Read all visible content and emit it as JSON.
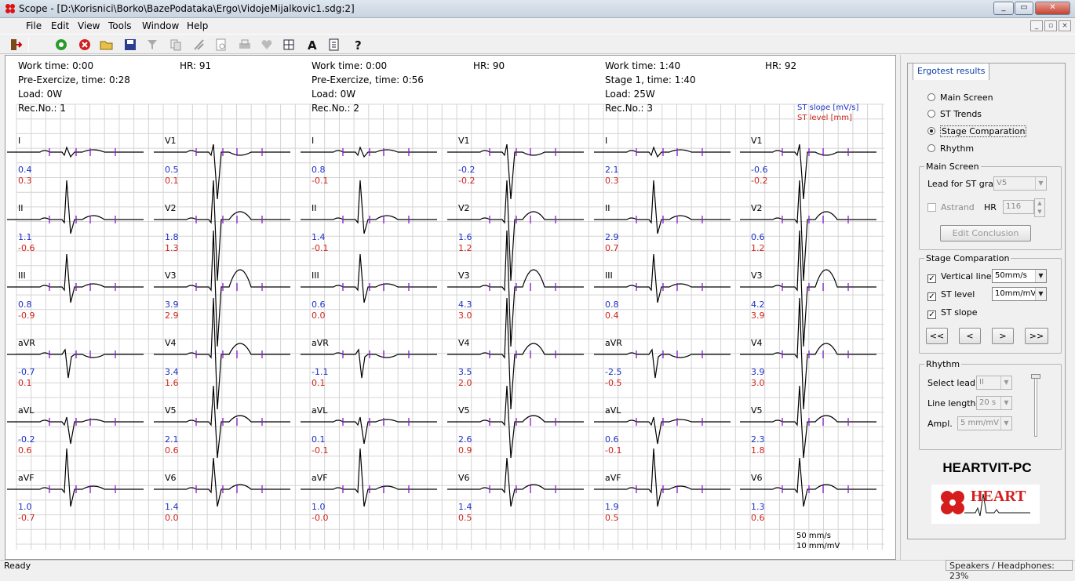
{
  "window": {
    "title": "Scope - [D:\\Korisnici\\Borko\\BazePodataka\\Ergo\\VidojeMijalkovic1.sdg:2]"
  },
  "menu": [
    "File",
    "Edit",
    "View",
    "Tools",
    "Window",
    "Help"
  ],
  "toolbar_icons": [
    "exit-icon",
    "start-icon",
    "stop-icon",
    "open-icon",
    "save-icon",
    "filter-icon",
    "copy-icon",
    "calibrate-icon",
    "preview-icon",
    "print-icon",
    "heart-icon",
    "grid-icon",
    "text-a-icon",
    "report-icon",
    "help-icon"
  ],
  "legend": {
    "st_slope": "ST slope [mV/s]",
    "st_level": "ST level [mm]"
  },
  "scale": {
    "speed": "50 mm/s",
    "gain": "10 mm/mV"
  },
  "records": [
    {
      "work_time": "Work time: 0:00",
      "hr": "HR: 91",
      "stage": "Pre-Exercize, time: 0:28",
      "load": "Load: 0W",
      "rec": "Rec.No.:  1",
      "leads": [
        {
          "name": "I",
          "slope": "0.4",
          "level": "0.3"
        },
        {
          "name": "V1",
          "slope": "0.5",
          "level": "0.1"
        },
        {
          "name": "II",
          "slope": "1.1",
          "level": "-0.6"
        },
        {
          "name": "V2",
          "slope": "1.8",
          "level": "1.3"
        },
        {
          "name": "III",
          "slope": "0.8",
          "level": "-0.9"
        },
        {
          "name": "V3",
          "slope": "3.9",
          "level": "2.9"
        },
        {
          "name": "aVR",
          "slope": "-0.7",
          "level": "0.1"
        },
        {
          "name": "V4",
          "slope": "3.4",
          "level": "1.6"
        },
        {
          "name": "aVL",
          "slope": "-0.2",
          "level": "0.6"
        },
        {
          "name": "V5",
          "slope": "2.1",
          "level": "0.6"
        },
        {
          "name": "aVF",
          "slope": "1.0",
          "level": "-0.7"
        },
        {
          "name": "V6",
          "slope": "1.4",
          "level": "0.0"
        }
      ]
    },
    {
      "work_time": "Work time: 0:00",
      "hr": "HR: 90",
      "stage": "Pre-Exercize, time: 0:56",
      "load": "Load: 0W",
      "rec": "Rec.No.:  2",
      "leads": [
        {
          "name": "I",
          "slope": "0.8",
          "level": "-0.1"
        },
        {
          "name": "V1",
          "slope": "-0.2",
          "level": "-0.2"
        },
        {
          "name": "II",
          "slope": "1.4",
          "level": "-0.1"
        },
        {
          "name": "V2",
          "slope": "1.6",
          "level": "1.2"
        },
        {
          "name": "III",
          "slope": "0.6",
          "level": "0.0"
        },
        {
          "name": "V3",
          "slope": "4.3",
          "level": "3.0"
        },
        {
          "name": "aVR",
          "slope": "-1.1",
          "level": "0.1"
        },
        {
          "name": "V4",
          "slope": "3.5",
          "level": "2.0"
        },
        {
          "name": "aVL",
          "slope": "0.1",
          "level": "-0.1"
        },
        {
          "name": "V5",
          "slope": "2.6",
          "level": "0.9"
        },
        {
          "name": "aVF",
          "slope": "1.0",
          "level": "-0.0"
        },
        {
          "name": "V6",
          "slope": "1.4",
          "level": "0.5"
        }
      ]
    },
    {
      "work_time": "Work time: 1:40",
      "hr": "HR: 92",
      "stage": "Stage 1, time: 1:40",
      "load": "Load: 25W",
      "rec": "Rec.No.:  3",
      "leads": [
        {
          "name": "I",
          "slope": "2.1",
          "level": "0.3"
        },
        {
          "name": "V1",
          "slope": "-0.6",
          "level": "-0.2"
        },
        {
          "name": "II",
          "slope": "2.9",
          "level": "0.7"
        },
        {
          "name": "V2",
          "slope": "0.6",
          "level": "1.2"
        },
        {
          "name": "III",
          "slope": "0.8",
          "level": "0.4"
        },
        {
          "name": "V3",
          "slope": "4.2",
          "level": "3.9"
        },
        {
          "name": "aVR",
          "slope": "-2.5",
          "level": "-0.5"
        },
        {
          "name": "V4",
          "slope": "3.9",
          "level": "3.0"
        },
        {
          "name": "aVL",
          "slope": "0.6",
          "level": "-0.1"
        },
        {
          "name": "V5",
          "slope": "2.3",
          "level": "1.8"
        },
        {
          "name": "aVF",
          "slope": "1.9",
          "level": "0.5"
        },
        {
          "name": "V6",
          "slope": "1.3",
          "level": "0.6"
        }
      ]
    }
  ],
  "panel": {
    "tab": "Ergotest results",
    "views": {
      "main": "Main Screen",
      "trends": "ST Trends",
      "stage": "Stage Comparation",
      "rhythm": "Rhythm",
      "selected": "Stage Comparation"
    },
    "main_screen": {
      "title": "Main Screen",
      "lead_label": "Lead for ST graph",
      "lead_value": "V5",
      "astrand": "Astrand",
      "hr_label": "HR",
      "hr_value": "116",
      "edit": "Edit Conclusion"
    },
    "stage_comp": {
      "title": "Stage Comparation",
      "vertical_lines": "Vertical lines",
      "vertical_value": "50mm/s",
      "st_level": "ST level",
      "st_level_value": "10mm/mV",
      "st_slope": "ST slope",
      "first": "<<",
      "prev": "<",
      "next": ">",
      "last": ">>"
    },
    "rhythm": {
      "title": "Rhythm",
      "select_lead": "Select lead",
      "lead_value": "II",
      "line_length": "Line length",
      "line_value": "20 s",
      "ampl": "Ampl.",
      "ampl_value": "5 mm/mV"
    },
    "brand": "HEARTVIT-PC",
    "logo_text": "HEART"
  },
  "status": {
    "left": "Ready",
    "right": "Speakers / Headphones: 23%"
  },
  "colors": {
    "slope": "#1c31c4",
    "level": "#d0241a",
    "grid": "#d4d4d4",
    "marker": "#8a1fc9",
    "trace": "#000000"
  }
}
